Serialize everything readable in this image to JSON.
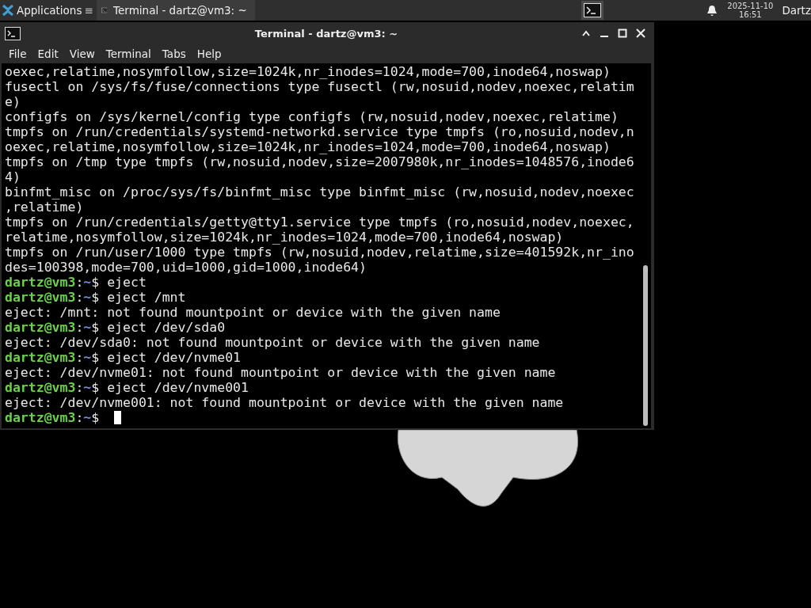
{
  "taskbar": {
    "apps_menu": "Applications",
    "apps_menu_glyph": "≡",
    "window_buttons": [
      {
        "title": "Terminal - dartz@vm3: ~",
        "selected": true
      }
    ],
    "date": "2025-11-10",
    "time": "16:51",
    "user": "Dartz"
  },
  "window": {
    "title": "Terminal - dartz@vm3: ~",
    "menu": [
      "File",
      "Edit",
      "View",
      "Terminal",
      "Tabs",
      "Help"
    ],
    "lines": [
      {
        "kind": "output",
        "text": "oexec,relatime,nosymfollow,size=1024k,nr_inodes=1024,mode=700,inode64,noswap)"
      },
      {
        "kind": "output",
        "text": "fusectl on /sys/fs/fuse/connections type fusectl (rw,nosuid,nodev,noexec,relatim"
      },
      {
        "kind": "output",
        "text": "e)"
      },
      {
        "kind": "output",
        "text": "configfs on /sys/kernel/config type configfs (rw,nosuid,nodev,noexec,relatime)"
      },
      {
        "kind": "output",
        "text": "tmpfs on /run/credentials/systemd-networkd.service type tmpfs (ro,nosuid,nodev,n"
      },
      {
        "kind": "output",
        "text": "oexec,relatime,nosymfollow,size=1024k,nr_inodes=1024,mode=700,inode64,noswap)"
      },
      {
        "kind": "output",
        "text": "tmpfs on /tmp type tmpfs (rw,nosuid,nodev,size=2007980k,nr_inodes=1048576,inode6"
      },
      {
        "kind": "output",
        "text": "4)"
      },
      {
        "kind": "output",
        "text": "binfmt_misc on /proc/sys/fs/binfmt_misc type binfmt_misc (rw,nosuid,nodev,noexec"
      },
      {
        "kind": "output",
        "text": ",relatime)"
      },
      {
        "kind": "output",
        "text": "tmpfs on /run/credentials/getty@tty1.service type tmpfs (ro,nosuid,nodev,noexec,"
      },
      {
        "kind": "output",
        "text": "relatime,nosymfollow,size=1024k,nr_inodes=1024,mode=700,inode64,noswap)"
      },
      {
        "kind": "output",
        "text": "tmpfs on /run/user/1000 type tmpfs (rw,nosuid,nodev,relatime,size=401592k,nr_ino"
      },
      {
        "kind": "output",
        "text": "des=100398,mode=700,uid=1000,gid=1000,inode64)"
      },
      {
        "kind": "prompt",
        "host": "dartz@vm3",
        "sep": ":",
        "path": "~",
        "sign": "$",
        "command": "eject"
      },
      {
        "kind": "prompt",
        "host": "dartz@vm3",
        "sep": ":",
        "path": "~",
        "sign": "$",
        "command": "eject /mnt"
      },
      {
        "kind": "output",
        "text": "eject: /mnt: not found mountpoint or device with the given name"
      },
      {
        "kind": "prompt",
        "host": "dartz@vm3",
        "sep": ":",
        "path": "~",
        "sign": "$",
        "command": "eject /dev/sda0"
      },
      {
        "kind": "output",
        "text": "eject: /dev/sda0: not found mountpoint or device with the given name"
      },
      {
        "kind": "prompt",
        "host": "dartz@vm3",
        "sep": ":",
        "path": "~",
        "sign": "$",
        "command": "eject /dev/nvme01"
      },
      {
        "kind": "output",
        "text": "eject: /dev/nvme01: not found mountpoint or device with the given name"
      },
      {
        "kind": "prompt",
        "host": "dartz@vm3",
        "sep": ":",
        "path": "~",
        "sign": "$",
        "command": "eject /dev/nvme001"
      },
      {
        "kind": "output",
        "text": "eject: /dev/nvme001: not found mountpoint or device with the given name"
      },
      {
        "kind": "prompt",
        "host": "dartz@vm3",
        "sep": ":",
        "path": "~",
        "sign": "$",
        "cursor": true
      }
    ]
  }
}
